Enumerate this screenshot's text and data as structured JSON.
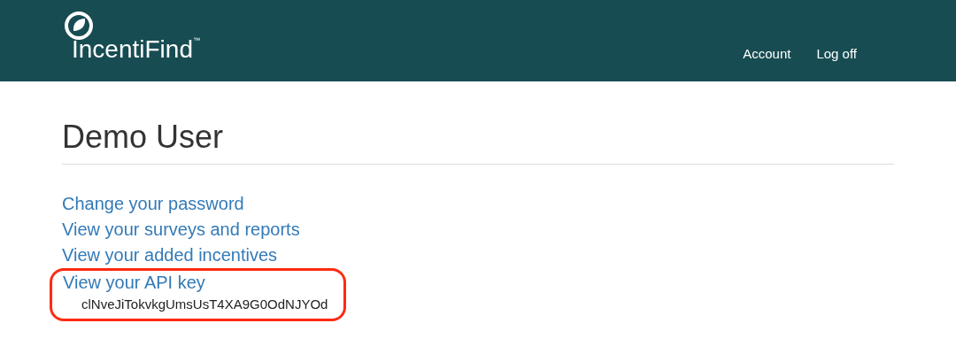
{
  "header": {
    "logo": "IncentiFind",
    "trademark": "™",
    "nav": [
      "Account",
      "Log off"
    ]
  },
  "page": {
    "title": "Demo User",
    "links": [
      "Change your password",
      "View your surveys and reports",
      "View your added incentives"
    ],
    "api": {
      "link": "View your API key",
      "key": "clNveJiTokvkgUmsUsT4XA9G0OdNJYOd",
      "highlighted": true
    }
  }
}
